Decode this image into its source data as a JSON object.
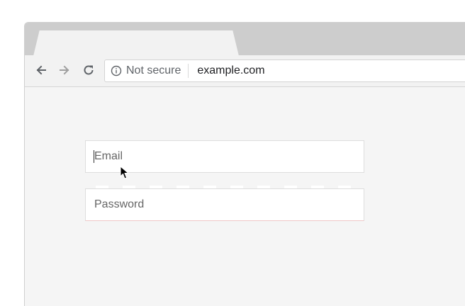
{
  "toolbar": {
    "back_icon": "arrow-left-icon",
    "forward_icon": "arrow-right-icon",
    "reload_icon": "reload-icon",
    "security_icon": "info-icon",
    "security_label": "Not secure",
    "url": "example.com"
  },
  "form": {
    "email": {
      "placeholder": "Email",
      "value": ""
    },
    "password": {
      "placeholder": "Password",
      "value": ""
    }
  },
  "colors": {
    "tabstrip": "#cdcdcd",
    "toolbar": "#f2f2f2",
    "page_background": "#f5f5f5",
    "field_background": "#ffffff"
  }
}
